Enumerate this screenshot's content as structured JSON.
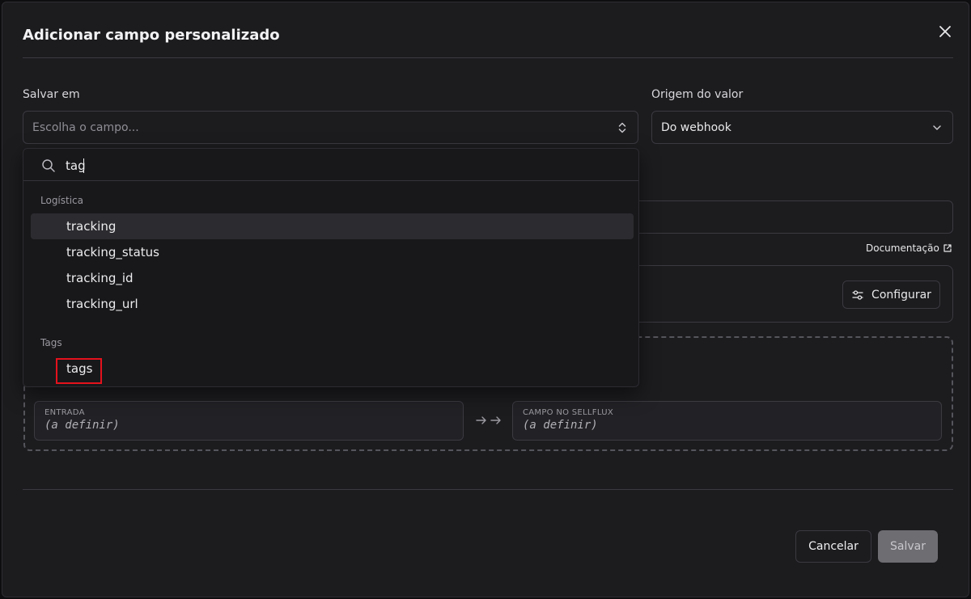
{
  "modal": {
    "title": "Adicionar campo personalizado"
  },
  "form": {
    "save_in": {
      "label": "Salvar em",
      "placeholder": "Escolha o campo..."
    },
    "value_origin": {
      "label": "Origem do valor",
      "value": "Do webhook"
    },
    "documentation_link": "Documentação",
    "configure_button": "Configurar"
  },
  "mapping": {
    "input_caption": "ENTRADA",
    "input_value": "(a definir)",
    "target_caption": "CAMPO NO SELLFLUX",
    "target_value": "(a definir)"
  },
  "dropdown": {
    "search_value": "tag",
    "groups": [
      {
        "label": "Logística",
        "items": [
          "tracking",
          "tracking_status",
          "tracking_id",
          "tracking_url"
        ]
      },
      {
        "label": "Tags",
        "items": [
          "tags"
        ]
      }
    ]
  },
  "footer": {
    "cancel": "Cancelar",
    "save": "Salvar"
  },
  "colors": {
    "background": "#1c1c1f",
    "highlight_border": "#e5121c",
    "save_disabled": "#6d6d72"
  }
}
